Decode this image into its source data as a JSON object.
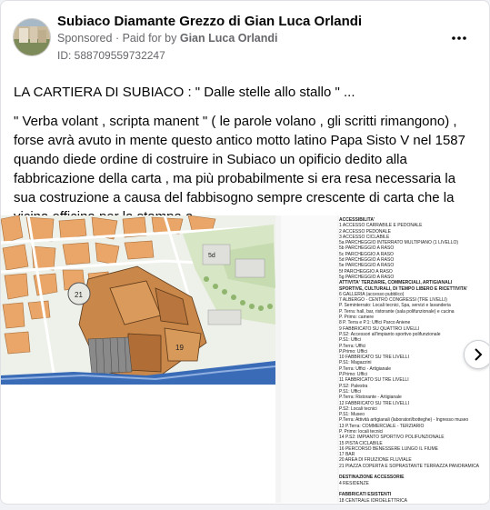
{
  "header": {
    "page_name": "Subiaco Diamante Grezzo di Gian Luca Orlandi",
    "sponsored_label": "Sponsored",
    "paid_for_prefix": "Paid for by",
    "paid_for_name": "Gian Luca Orlandi",
    "ad_id": "ID: 588709559732247",
    "more_icon": "more-horizontal-icon"
  },
  "post": {
    "title_line": "LA CARTIERA DI SUBIACO : \" Dalle stelle allo stallo \" ...",
    "body": "\" Verba volant , scripta manent \" ( le parole volano , gli scritti rimangono) , forse avrà avuto in mente questo antico motto latino Papa Sisto V nel 1587 quando diede ordine di costruire in Subiaco un opificio dedito alla fabbricazione della carta , ma più probabilmente si era resa necessaria la sua costruzione a causa del fabbisogno sempre crescente di carta che la vicina officina per la stampa a…"
  },
  "media": {
    "next_icon": "chevron-right-icon",
    "map_labels": [
      "21",
      "19",
      "5d"
    ],
    "legend": [
      {
        "text": "ACCESSIBILITA'",
        "bold": true
      },
      {
        "text": "1   ACCESSO CARRABILE E PEDONALE"
      },
      {
        "text": "2   ACCESSO PEDONALE"
      },
      {
        "text": "3   ACCESSO CICLABILE"
      },
      {
        "text": "5a  PARCHEGGIO INTERRATO MULTIPIANO (1 LIVELLO)"
      },
      {
        "text": "5b  PARCHEGGIO A RASO"
      },
      {
        "text": "5c  PARCHEGGIO A RASO"
      },
      {
        "text": "5d  PARCHEGGIO A RASO"
      },
      {
        "text": "5e  PARCHEGGIO A RASO"
      },
      {
        "text": "5f  PARCHEGGIO A RASO"
      },
      {
        "text": "5g  PARCHEGGIO A RASO"
      },
      {
        "text": "ATTIVITA' TERZIARIE, COMMERCIALI, ARTIGIANALI",
        "bold": true
      },
      {
        "text": "SPORTIVE, CULTURALI, DI TEMPO LIBERO E RICETTIVITA'",
        "bold": true
      },
      {
        "text": "6   GALLERIA (accesso pubblico)"
      },
      {
        "text": "7   ALBERGO - CENTRO CONGRESSI (TRE LIVELLI)"
      },
      {
        "text": "    P. Seminterrato: Locali tecnici, Spa, servizi e lavanderia"
      },
      {
        "text": "    P. Terra: hall, bar, ristorante (sala polifunzionale) e cucina"
      },
      {
        "text": "    P. Primo: camere"
      },
      {
        "text": "8   P. Terra e P.1: Uffici Parco Aniene"
      },
      {
        "text": "9   FABBRICATO SU QUATTRO LIVELLI"
      },
      {
        "text": "    P.S2: Accessori all'impianto sportivo polifunzionale"
      },
      {
        "text": "    P.S1: Uffici"
      },
      {
        "text": "    P.Terra: Uffici"
      },
      {
        "text": "    P.Primo: Uffici"
      },
      {
        "text": "10  FABBRICATO SU TRE LIVELLI"
      },
      {
        "text": "    P.S1: Magazzini"
      },
      {
        "text": "    P.Terra: Uffici - Artigianale"
      },
      {
        "text": "    P.Primo: Uffici"
      },
      {
        "text": "11  FABBRICATO SU TRE LIVELLI"
      },
      {
        "text": "    P.S2: Palestra"
      },
      {
        "text": "    P.S1: Uffici"
      },
      {
        "text": "    P.Terra: Ristorante - Artigianale"
      },
      {
        "text": "12  FABBRICATO SU TRE LIVELLI"
      },
      {
        "text": "    P.S2: Locali tecnici"
      },
      {
        "text": "    P.S1: Museo"
      },
      {
        "text": "    P.Terra: Attività artigianali (laboratori/botteghe) - Ingresso museo"
      },
      {
        "text": "13  P.Terra: COMMERCIALE - TERZIARIO"
      },
      {
        "text": "    P. Primo: locali tecnici"
      },
      {
        "text": "14  P.S2: IMPIANTO SPORTIVO POLIFUNZIONALE"
      },
      {
        "text": "15  PISTA CICLABILE"
      },
      {
        "text": "16  PERCORSO BENESSERE LUNGO IL FIUME"
      },
      {
        "text": "17  BAR"
      },
      {
        "text": "20  AREA DI FRUIZIONE FLUVIALE"
      },
      {
        "text": "21  PIAZZA COPERTA E SOPRASTANTE TERRAZZA PANORAMICA"
      },
      {
        "text": ""
      },
      {
        "text": "DESTINAZIONE ACCESSORIE",
        "bold": true
      },
      {
        "text": "4   RESIDENZE"
      },
      {
        "text": ""
      },
      {
        "text": "FABBRICATI ESISTENTI",
        "bold": true
      },
      {
        "text": "18  CENTRALE IDROELETTRICA"
      },
      {
        "text": "19  OFFICINA"
      }
    ]
  }
}
